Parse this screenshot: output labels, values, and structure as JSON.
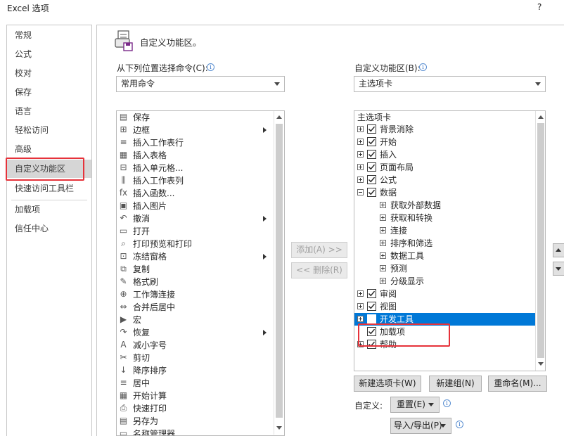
{
  "window": {
    "title": "Excel 选项",
    "help": "?"
  },
  "sidebar": {
    "items": [
      "常规",
      "公式",
      "校对",
      "保存",
      "语言",
      "轻松访问",
      "高级",
      "自定义功能区",
      "快速访问工具栏",
      "加载项",
      "信任中心"
    ],
    "active": "自定义功能区"
  },
  "header": {
    "title": "自定义功能区。"
  },
  "left": {
    "label": "从下列位置选择命令(C):",
    "dropdown_value": "常用命令",
    "commands": [
      {
        "label": "保存",
        "icon": "save-icon",
        "glyph": "▤"
      },
      {
        "label": "边框",
        "icon": "borders-icon",
        "glyph": "⊞",
        "submenu": true
      },
      {
        "label": "插入工作表行",
        "icon": "insert-row-icon",
        "glyph": "≡"
      },
      {
        "label": "插入表格",
        "icon": "insert-table-icon",
        "glyph": "▦"
      },
      {
        "label": "插入单元格...",
        "icon": "insert-cells-icon",
        "glyph": "⊟"
      },
      {
        "label": "插入工作表列",
        "icon": "insert-column-icon",
        "glyph": "⫼"
      },
      {
        "label": "插入函数...",
        "icon": "function-icon",
        "glyph": "fx"
      },
      {
        "label": "插入图片",
        "icon": "picture-icon",
        "glyph": "▣"
      },
      {
        "label": "撤消",
        "icon": "undo-icon",
        "glyph": "↶",
        "submenu": true
      },
      {
        "label": "打开",
        "icon": "folder-icon",
        "glyph": "▭"
      },
      {
        "label": "打印预览和打印",
        "icon": "print-preview-icon",
        "glyph": "⌕"
      },
      {
        "label": "冻结窗格",
        "icon": "freeze-panes-icon",
        "glyph": "⊡",
        "submenu": true
      },
      {
        "label": "复制",
        "icon": "copy-icon",
        "glyph": "⧉"
      },
      {
        "label": "格式刷",
        "icon": "format-painter-icon",
        "glyph": "✎"
      },
      {
        "label": "工作簿连接",
        "icon": "connections-icon",
        "glyph": "⊕"
      },
      {
        "label": "合并后居中",
        "icon": "merge-center-icon",
        "glyph": "⇔"
      },
      {
        "label": "宏",
        "icon": "macro-icon",
        "glyph": "▶"
      },
      {
        "label": "恢复",
        "icon": "redo-icon",
        "glyph": "↷",
        "submenu": true
      },
      {
        "label": "减小字号",
        "icon": "decrease-font-icon",
        "glyph": "A"
      },
      {
        "label": "剪切",
        "icon": "cut-icon",
        "glyph": "✂"
      },
      {
        "label": "降序排序",
        "icon": "sort-desc-icon",
        "glyph": "↓"
      },
      {
        "label": "居中",
        "icon": "align-center-icon",
        "glyph": "≡"
      },
      {
        "label": "开始计算",
        "icon": "calculator-icon",
        "glyph": "▦"
      },
      {
        "label": "快速打印",
        "icon": "quick-print-icon",
        "glyph": "⎙"
      },
      {
        "label": "另存为",
        "icon": "save-as-icon",
        "glyph": "▤"
      },
      {
        "label": "名称管理器",
        "icon": "name-manager-icon",
        "glyph": "▭"
      }
    ]
  },
  "middle": {
    "add_label": "添加(A) >>",
    "remove_label": "<< 删除(R)"
  },
  "right": {
    "label": "自定义功能区(B):",
    "dropdown_value": "主选项卡",
    "list_header": "主选项卡",
    "tree": [
      {
        "label": "背景消除",
        "level": 0,
        "expander": "plus",
        "checked": true
      },
      {
        "label": "开始",
        "level": 0,
        "expander": "plus",
        "checked": true
      },
      {
        "label": "插入",
        "level": 0,
        "expander": "plus",
        "checked": true
      },
      {
        "label": "页面布局",
        "level": 0,
        "expander": "plus",
        "checked": true
      },
      {
        "label": "公式",
        "level": 0,
        "expander": "plus",
        "checked": true
      },
      {
        "label": "数据",
        "level": 0,
        "expander": "minus",
        "checked": true
      },
      {
        "label": "获取外部数据",
        "level": 1,
        "expander": "plus"
      },
      {
        "label": "获取和转换",
        "level": 1,
        "expander": "plus"
      },
      {
        "label": "连接",
        "level": 1,
        "expander": "plus"
      },
      {
        "label": "排序和筛选",
        "level": 1,
        "expander": "plus"
      },
      {
        "label": "数据工具",
        "level": 1,
        "expander": "plus"
      },
      {
        "label": "预测",
        "level": 1,
        "expander": "plus"
      },
      {
        "label": "分级显示",
        "level": 1,
        "expander": "plus"
      },
      {
        "label": "审阅",
        "level": 0,
        "expander": "plus",
        "checked": true
      },
      {
        "label": "视图",
        "level": 0,
        "expander": "plus",
        "checked": true
      },
      {
        "label": "开发工具",
        "level": 0,
        "expander": "plus",
        "checked": true,
        "selected": true
      },
      {
        "label": "加载项",
        "level": 0,
        "expander": "none",
        "checked": true
      },
      {
        "label": "帮助",
        "level": 0,
        "expander": "plus",
        "checked": true
      }
    ],
    "new_tab_label": "新建选项卡(W)",
    "new_group_label": "新建组(N)",
    "rename_label": "重命名(M)...",
    "customize_label": "自定义:",
    "reset_label": "重置(E)",
    "import_export_label": "导入/导出(P)"
  },
  "colors": {
    "selection": "#0078d7",
    "highlight": "#e6323a"
  }
}
